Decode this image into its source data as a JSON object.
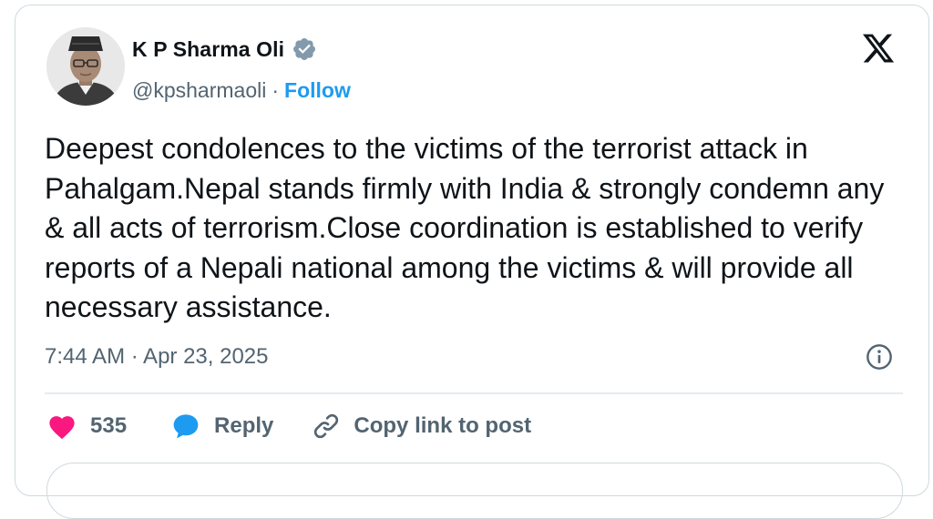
{
  "author": {
    "name": "K P Sharma Oli",
    "handle": "@kpsharmaoli",
    "separator": "·",
    "follow_label": "Follow",
    "verified": true
  },
  "tweet": {
    "text": "Deepest condolences to the victims of the terrorist attack in Pahalgam.Nepal stands firmly with India & strongly condemn any & all acts of terrorism.Close coordination is established to verify reports of a Nepali national among the victims & will provide all necessary assistance.",
    "timestamp": "7:44 AM · Apr 23, 2025"
  },
  "actions": {
    "like_count": "535",
    "reply_label": "Reply",
    "copy_link_label": "Copy link to post"
  },
  "icons": {
    "x_logo": "x-logo-icon",
    "verified": "verified-badge-icon",
    "info": "info-icon",
    "like": "heart-icon",
    "reply": "speech-bubble-icon",
    "copy_link": "link-icon"
  },
  "colors": {
    "accent": "#1d9bf0",
    "text": "#0f1419",
    "secondary": "#536471",
    "like": "#f91880",
    "verified": "#829aab"
  }
}
